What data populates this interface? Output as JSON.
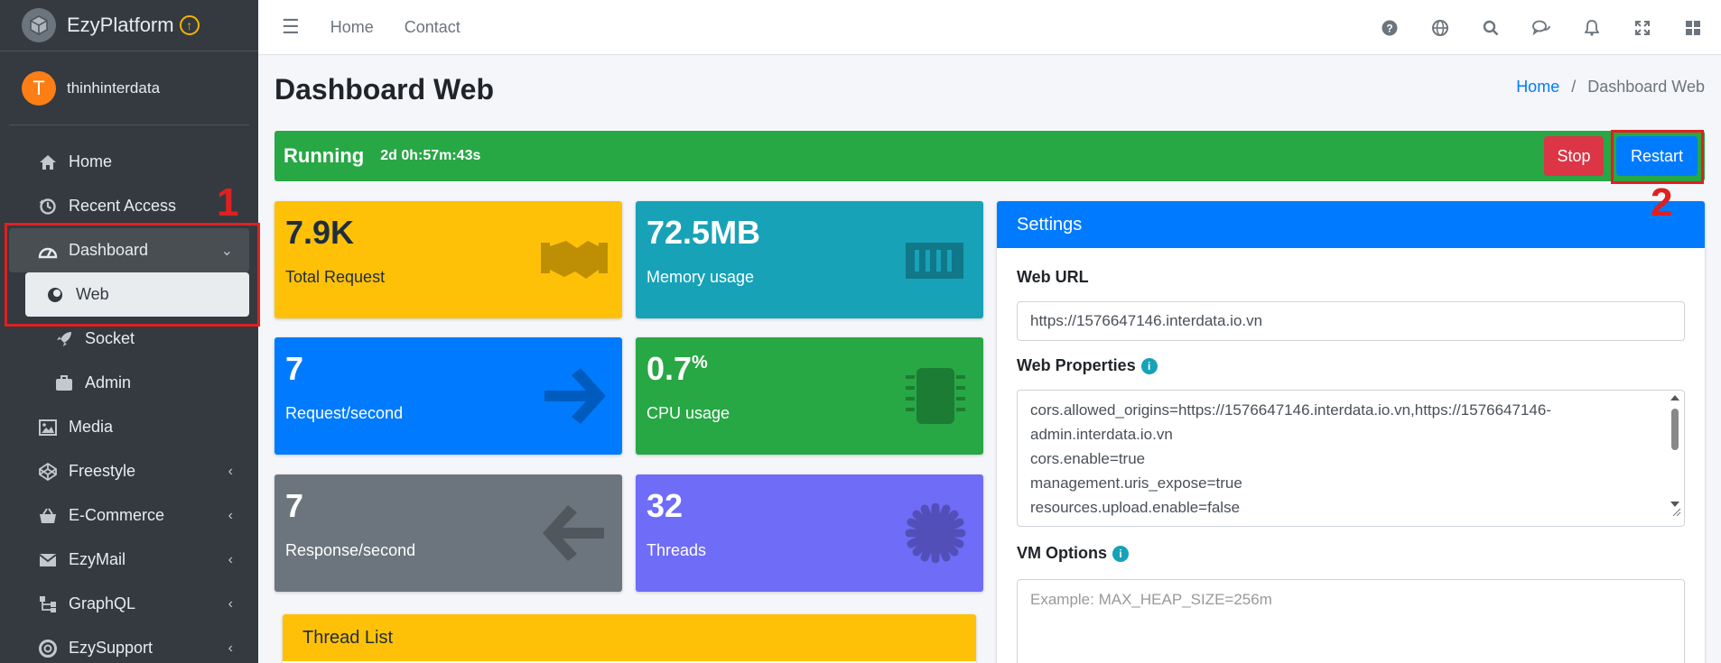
{
  "brand": {
    "name": "EzyPlatform"
  },
  "user": {
    "initial": "T",
    "name": "thinhinterdata"
  },
  "sidebar": {
    "items": [
      {
        "label": "Home",
        "icon": "home-icon"
      },
      {
        "label": "Recent Access",
        "icon": "history-icon"
      },
      {
        "label": "Dashboard",
        "icon": "gauge-icon",
        "chevron": "down"
      },
      {
        "label": "Web",
        "icon": "circle-half-icon",
        "active": true
      },
      {
        "label": "Socket",
        "icon": "rocket-icon"
      },
      {
        "label": "Admin",
        "icon": "briefcase-icon"
      },
      {
        "label": "Media",
        "icon": "image-icon"
      },
      {
        "label": "Freestyle",
        "icon": "codepen-icon",
        "chevron": "left"
      },
      {
        "label": "E-Commerce",
        "icon": "basket-icon",
        "chevron": "left"
      },
      {
        "label": "EzyMail",
        "icon": "envelope-icon",
        "chevron": "left"
      },
      {
        "label": "GraphQL",
        "icon": "sitemap-icon",
        "chevron": "left"
      },
      {
        "label": "EzySupport",
        "icon": "lifebuoy-icon",
        "chevron": "left"
      }
    ]
  },
  "topbar": {
    "links": [
      "Home",
      "Contact"
    ],
    "icons": [
      "help-icon",
      "globe-icon",
      "search-icon",
      "comments-icon",
      "bell-icon",
      "expand-icon",
      "grid-icon"
    ]
  },
  "page": {
    "title": "Dashboard Web",
    "breadcrumb": {
      "home": "Home",
      "sep": "/",
      "current": "Dashboard Web"
    }
  },
  "status": {
    "label": "Running",
    "uptime": "2d 0h:57m:43s",
    "stop_label": "Stop",
    "restart_label": "Restart",
    "color": "#28a745"
  },
  "annotations": {
    "one": "1",
    "two": "2",
    "color": "#e02020"
  },
  "stats": {
    "total_request": {
      "value": "7.9K",
      "label": "Total Request"
    },
    "memory": {
      "value": "72.5MB",
      "label": "Memory usage"
    },
    "req_per_sec": {
      "value": "7",
      "label": "Request/second"
    },
    "cpu": {
      "value": "0.7",
      "unit": "%",
      "label": "CPU usage"
    },
    "resp_per_sec": {
      "value": "7",
      "label": "Response/second"
    },
    "threads": {
      "value": "32",
      "label": "Threads"
    }
  },
  "thread_list": {
    "title": "Thread List"
  },
  "settings": {
    "title": "Settings",
    "web_url_label": "Web URL",
    "web_url_value": "https://1576647146.interdata.io.vn",
    "web_props_label": "Web Properties",
    "web_props_lines": [
      "cors.allowed_origins=https://1576647146.interdata.io.vn,https://1576647146-",
      "admin.interdata.io.vn",
      "cors.enable=true",
      "management.uris_expose=true",
      "resources.upload.enable=false"
    ],
    "vm_options_label": "VM Options",
    "vm_options_placeholder": "Example: MAX_HEAP_SIZE=256m"
  }
}
